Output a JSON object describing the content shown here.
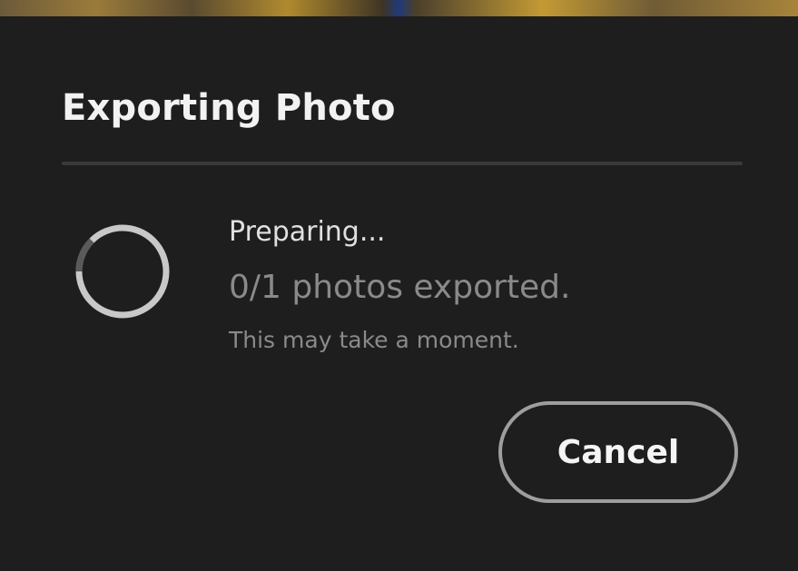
{
  "dialog": {
    "title": "Exporting Photo",
    "status_text": "Preparing...",
    "progress_text": "0/1 photos exported.",
    "note_text": "This may take a moment.",
    "cancel_label": "Cancel"
  },
  "spinner": {
    "icon": "loading-spinner-icon",
    "track_color": "#c8c8c8",
    "arc_color": "#5a5a5a"
  },
  "colors": {
    "background": "#1e1e1e",
    "title": "#f2f2f2",
    "secondary_text": "#8a8a8a",
    "button_border": "#9e9e9e"
  }
}
